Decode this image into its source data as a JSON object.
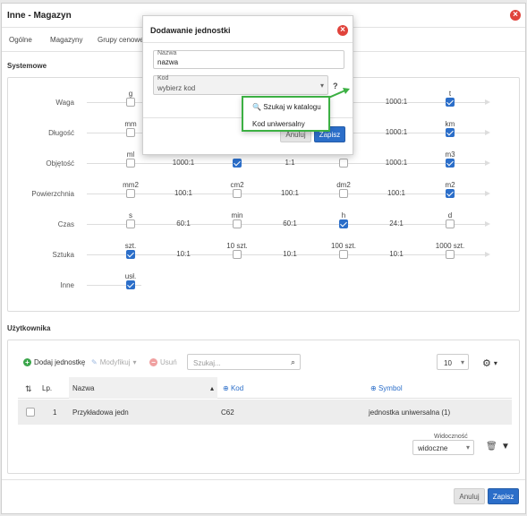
{
  "window": {
    "title": "Inne - Magazyn"
  },
  "tabs": [
    "Ogólne",
    "Magazyny",
    "Grupy cenowe"
  ],
  "systemowe": {
    "title": "Systemowe",
    "rows": [
      {
        "label": "Waga",
        "units": [
          "g",
          "",
          "",
          "t"
        ],
        "ratios": [
          "",
          "",
          "1000:1"
        ],
        "checked": [
          false,
          false,
          false,
          true
        ]
      },
      {
        "label": "Długość",
        "units": [
          "mm",
          "",
          "",
          "km"
        ],
        "ratios": [
          "",
          "",
          "1000:1"
        ],
        "checked": [
          false,
          false,
          false,
          true
        ]
      },
      {
        "label": "Objętość",
        "units": [
          "ml",
          "",
          "",
          "m3"
        ],
        "ratios": [
          "1000:1",
          "1:1",
          "1000:1"
        ],
        "checked": [
          false,
          true,
          false,
          true
        ]
      },
      {
        "label": "Powierzchnia",
        "units": [
          "mm2",
          "cm2",
          "dm2",
          "m2"
        ],
        "ratios": [
          "100:1",
          "100:1",
          "100:1"
        ],
        "checked": [
          false,
          false,
          false,
          true
        ]
      },
      {
        "label": "Czas",
        "units": [
          "s",
          "min",
          "h",
          "d"
        ],
        "ratios": [
          "60:1",
          "60:1",
          "24:1"
        ],
        "checked": [
          false,
          false,
          true,
          false
        ]
      },
      {
        "label": "Sztuka",
        "units": [
          "szt.",
          "10 szt.",
          "100 szt.",
          "1000 szt."
        ],
        "ratios": [
          "10:1",
          "10:1",
          "10:1"
        ],
        "checked": [
          true,
          false,
          false,
          false
        ]
      },
      {
        "label": "Inne",
        "units": [
          "usł."
        ],
        "ratios": [],
        "checked": [
          true
        ]
      }
    ]
  },
  "uzytkownika": {
    "title": "Użytkownika",
    "toolbar": {
      "add": "Dodaj jednostkę",
      "modify": "Modyfikuj",
      "delete": "Usuń",
      "search_placeholder": "Szukaj...",
      "page_size": "10"
    },
    "columns": {
      "lp": "Lp.",
      "name": "Nazwa",
      "code": "Kod",
      "symbol": "Symbol"
    },
    "rows": [
      {
        "lp": "1",
        "name": "Przykładowa jedn",
        "code": "C62",
        "symbol": "jednostka uniwersalna (1)"
      }
    ],
    "visibility": {
      "label": "Widoczność",
      "value": "widoczne"
    }
  },
  "footer": {
    "cancel": "Anuluj",
    "save": "Zapisz"
  },
  "dialog": {
    "title": "Dodawanie jednostki",
    "name_label": "Nazwa",
    "name_value": "nazwa",
    "code_label": "Kod",
    "code_value": "wybierz kod",
    "help": "?",
    "cancel": "Anuluj",
    "save": "Zapisz",
    "dropdown": {
      "search_catalog": "Szukaj w katalogu",
      "universal_code": "Kod uniwersalny"
    }
  },
  "colors": {
    "accent": "#2b6ec9",
    "close": "#e0433b",
    "highlight": "#3cb043"
  }
}
